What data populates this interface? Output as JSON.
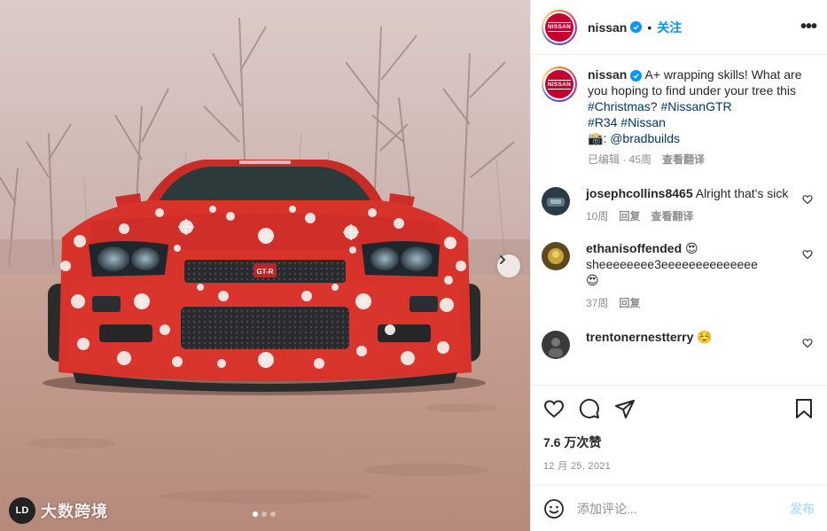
{
  "post": {
    "username": "nissan",
    "follow_label": "关注",
    "more_label": "•••",
    "avatar_text": "NISSAN"
  },
  "caption": {
    "username": "nissan",
    "text1": "A+ wrapping skills! What are you hoping to find under your tree this ",
    "tag1": "#Christmas",
    "text2": "? ",
    "tag2": "#NissanGTR",
    "tag3": "#R34",
    "tag4": "#Nissan",
    "emoji": "📸",
    "mention": "@bradbuilds",
    "edited": "已编辑 · 45周",
    "translate": "查看翻译"
  },
  "comments": [
    {
      "username": "josephcollins8465",
      "text": "Alright that's sick",
      "time": "10周",
      "reply": "回复",
      "translate": "查看翻译",
      "avatar_color": "#2b3a44"
    },
    {
      "username": "ethanisoffended",
      "username_emoji": "😍",
      "text": "sheeeeeeee3eeeeeeeeeeeeee",
      "text_emoji": "😍",
      "time": "37周",
      "reply": "回复",
      "avatar_color": "#5c4a1e"
    },
    {
      "username": "trentonernestterry",
      "username_emoji": "☺️",
      "avatar_color": "#3a3a3a"
    }
  ],
  "stats": {
    "likes": "7.6 万次赞",
    "date": "12 月 25, 2021"
  },
  "comment_box": {
    "placeholder": "添加评论...",
    "post_label": "发布"
  },
  "media": {
    "watermark_logo": "LD",
    "watermark_text": "大数跨境",
    "carousel_count": 3,
    "carousel_active": 0
  },
  "colors": {
    "accent": "#0095f6",
    "nissan_red": "#c3002f",
    "car_red": "#d7332b",
    "link": "#00376b"
  }
}
